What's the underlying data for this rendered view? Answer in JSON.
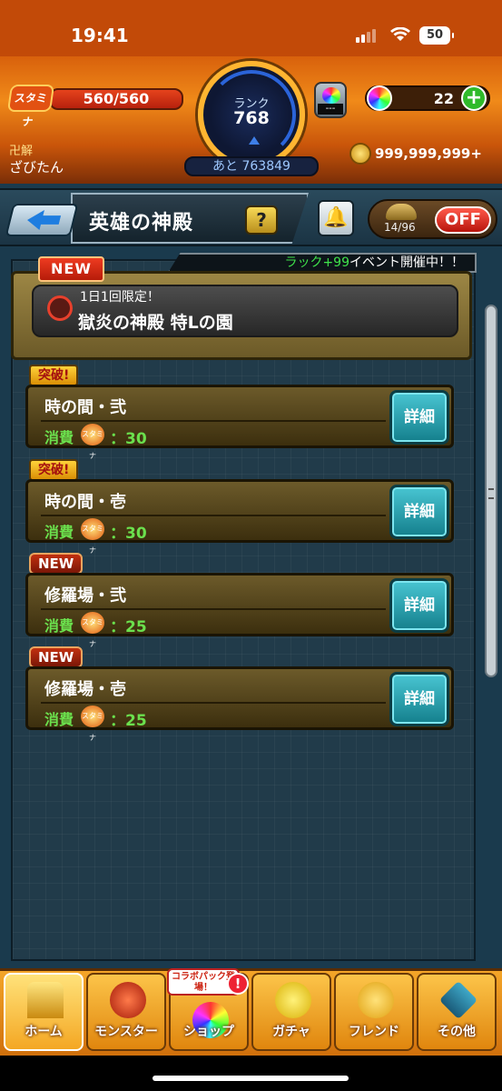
{
  "status_bar": {
    "time": "19:41",
    "battery": "50"
  },
  "header": {
    "stamina_label": "スタミナ",
    "stamina_value": "560/560",
    "title": "卍解",
    "username": "ざびたん",
    "rank_label": "ランク",
    "rank_value": "768",
    "rank_next": "あと 763849",
    "orb_box_value": "---",
    "orb_count": "22",
    "coins": "999,999,999+"
  },
  "titlebar": {
    "title": "英雄の神殿",
    "help": "?",
    "toggle_count": "14/96",
    "toggle_state": "OFF"
  },
  "event": {
    "luck": "ラック+99",
    "text": "イベント開催中！！"
  },
  "featured": {
    "badge": "NEW",
    "subtitle": "1日1回限定！",
    "title": "獄炎の神殿 特Lの園"
  },
  "quests": [
    {
      "badge": "突破!",
      "name": "時の間・弐",
      "cost_label": "消費",
      "cost_icon": "スタミナ",
      "cost": "：30",
      "detail": "詳細"
    },
    {
      "badge": "突破!",
      "name": "時の間・壱",
      "cost_label": "消費",
      "cost_icon": "スタミナ",
      "cost": "：30",
      "detail": "詳細"
    },
    {
      "badge": "NEW",
      "name": "修羅場・弐",
      "cost_label": "消費",
      "cost_icon": "スタミナ",
      "cost": "：25",
      "detail": "詳細"
    },
    {
      "badge": "NEW",
      "name": "修羅場・壱",
      "cost_label": "消費",
      "cost_icon": "スタミナ",
      "cost": "：25",
      "detail": "詳細"
    }
  ],
  "nav": {
    "collab_label": "コラボパック登場！",
    "collab_alert": "!",
    "items": [
      {
        "label": "ホーム",
        "icon": "home-icon"
      },
      {
        "label": "モンスター",
        "icon": "monster-icon"
      },
      {
        "label": "ショップ",
        "icon": "shop-icon"
      },
      {
        "label": "ガチャ",
        "icon": "gacha-icon"
      },
      {
        "label": "フレンド",
        "icon": "friend-icon"
      },
      {
        "label": "その他",
        "icon": "other-icon"
      }
    ]
  }
}
